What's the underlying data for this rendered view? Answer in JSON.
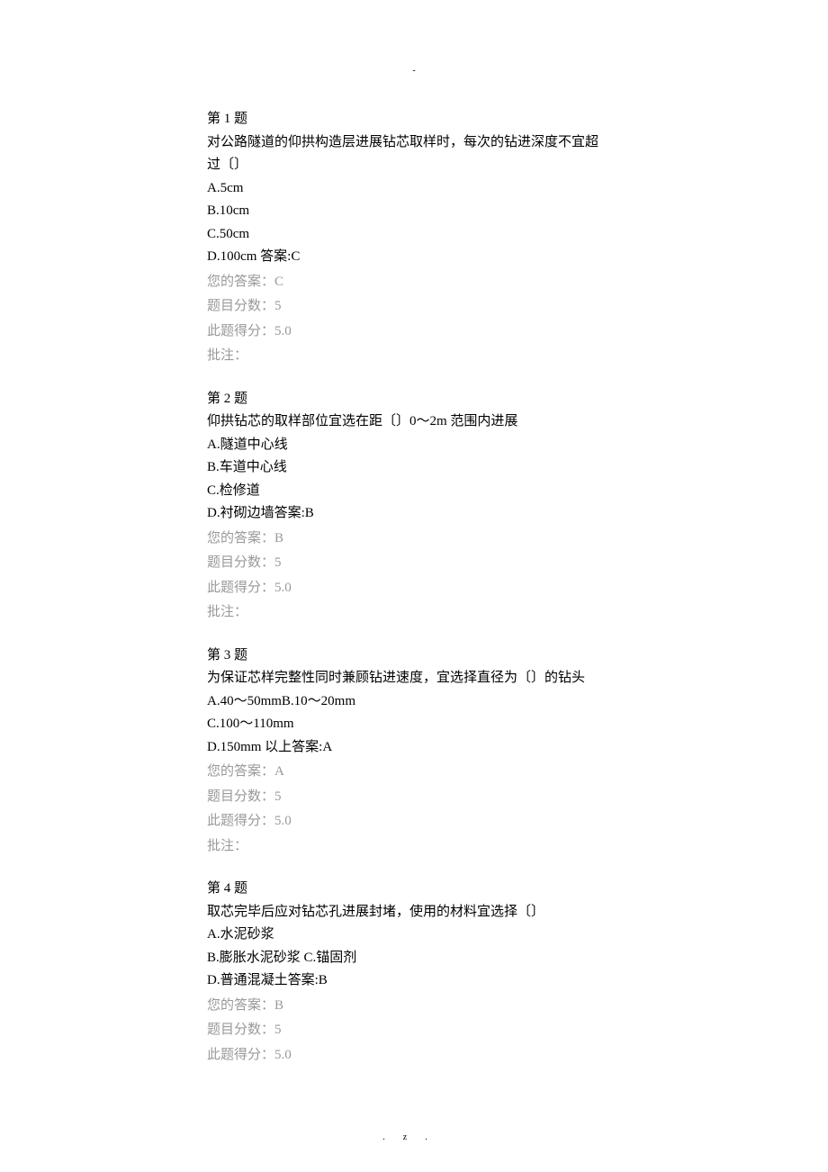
{
  "header_mark": "-",
  "footer_left": ".",
  "footer_right": "z.",
  "questions": [
    {
      "title": "第 1 题",
      "stem_lines": [
        "对公路隧道的仰拱构造层进展钻芯取样时，每次的钻进深度不宜超",
        "过〔〕"
      ],
      "options": [
        "A.5cm",
        "B.10cm",
        "C.50cm",
        "D.100cm 答案:C"
      ],
      "your_answer_label": "您的答案：",
      "your_answer": "C",
      "score_label": "题目分数：",
      "score": "5",
      "obtained_label": "此题得分：",
      "obtained": "5.0",
      "remark_label": "批注："
    },
    {
      "title": "第 2 题",
      "stem_lines": [
        "仰拱钻芯的取样部位宜选在距〔〕0～2m 范围内进展"
      ],
      "options": [
        "A.隧道中心线",
        "B.车道中心线",
        "C.检修道",
        "D.衬砌边墙答案:B"
      ],
      "your_answer_label": "您的答案：",
      "your_answer": "B",
      "score_label": "题目分数：",
      "score": "5",
      "obtained_label": "此题得分：",
      "obtained": "5.0",
      "remark_label": "批注："
    },
    {
      "title": "第 3 题",
      "stem_lines": [
        "为保证芯样完整性同时兼顾钻进速度，宜选择直径为〔〕的钻头"
      ],
      "options": [
        "A.40～50mmB.10～20mm",
        "C.100～110mm",
        "D.150mm 以上答案:A"
      ],
      "your_answer_label": "您的答案：",
      "your_answer": "A",
      "score_label": "题目分数：",
      "score": "5",
      "obtained_label": "此题得分：",
      "obtained": "5.0",
      "remark_label": "批注："
    },
    {
      "title": "第 4 题",
      "stem_lines": [
        "取芯完毕后应对钻芯孔进展封堵，使用的材料宜选择〔〕"
      ],
      "options": [
        "A.水泥砂浆",
        "B.膨胀水泥砂浆 C.锚固剂",
        "D.普通混凝土答案:B"
      ],
      "your_answer_label": "您的答案：",
      "your_answer": "B",
      "score_label": "题目分数：",
      "score": "5",
      "obtained_label": "此题得分：",
      "obtained": "5.0",
      "remark_label": ""
    }
  ]
}
